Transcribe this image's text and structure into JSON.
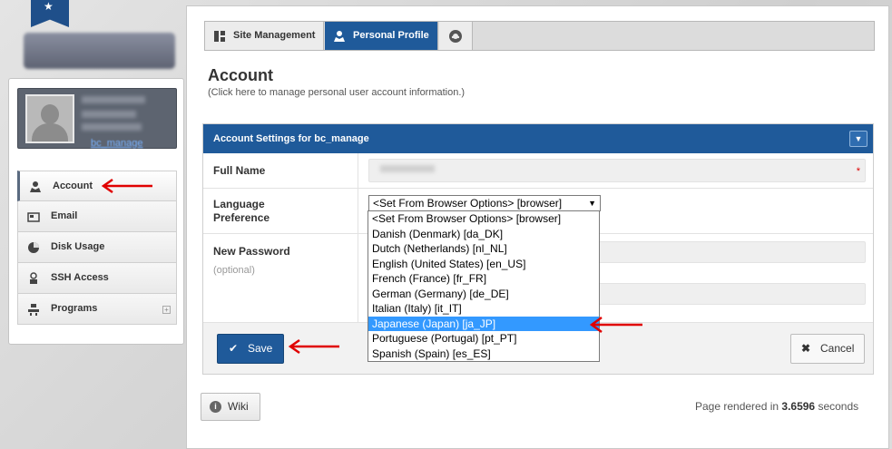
{
  "sidebar": {
    "user_name": "bc_manage",
    "items": [
      {
        "label": "Account",
        "icon": "user-icon"
      },
      {
        "label": "Email",
        "icon": "email-icon"
      },
      {
        "label": "Disk Usage",
        "icon": "pie-chart-icon"
      },
      {
        "label": "SSH Access",
        "icon": "ssh-icon"
      },
      {
        "label": "Programs",
        "icon": "programs-icon"
      }
    ],
    "expand_glyph": "+"
  },
  "tabs": [
    {
      "label": "Site Management",
      "icon": "grid-icon"
    },
    {
      "label": "Personal Profile",
      "icon": "user-icon"
    },
    {
      "label": "",
      "icon": "settings-icon"
    }
  ],
  "page": {
    "title": "Account",
    "subtitle": "(Click here to manage personal user account information.)"
  },
  "card": {
    "title": "Account Settings for bc_manage",
    "rows": {
      "full_name": {
        "label": "Full Name",
        "required_mark": "*"
      },
      "language": {
        "label_line1": "Language",
        "label_line2": "Preference",
        "selected": "<Set From Browser Options> [browser]"
      },
      "password": {
        "label": "New Password",
        "hint": "(optional)"
      }
    },
    "language_options": [
      "<Set From Browser Options> [browser]",
      "Danish (Denmark) [da_DK]",
      "Dutch (Netherlands) [nl_NL]",
      "English (United States) [en_US]",
      "French (France) [fr_FR]",
      "German (Germany) [de_DE]",
      "Italian (Italy) [it_IT]",
      "Japanese (Japan) [ja_JP]",
      "Portuguese (Portugal) [pt_PT]",
      "Spanish (Spain) [es_ES]"
    ],
    "highlighted_option": "Japanese (Japan) [ja_JP]",
    "save_label": "Save",
    "cancel_label": "Cancel"
  },
  "footer": {
    "wiki_label": "Wiki",
    "render_prefix": "Page rendered in ",
    "render_value": "3.6596",
    "render_suffix": " seconds"
  },
  "colors": {
    "brand_blue": "#1f5a9a",
    "highlight": "#3399ff",
    "annotation_red": "#e00000"
  }
}
